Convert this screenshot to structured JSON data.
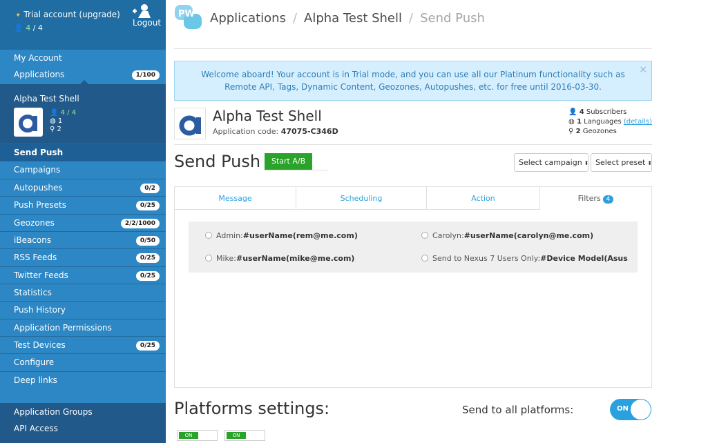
{
  "sidebar": {
    "trial": "Trial account (upgrade)",
    "users": {
      "current": "4",
      "total": "/ 4"
    },
    "logout": "Logout",
    "my_account": "My Account",
    "applications": {
      "label": "Applications",
      "badge": "1/100"
    },
    "app": {
      "name": "Alpha Test Shell",
      "users": "4 / 4",
      "stat2": "1",
      "stat3": "2"
    },
    "items": [
      {
        "label": "Send Push",
        "badge": ""
      },
      {
        "label": "Campaigns",
        "badge": ""
      },
      {
        "label": "Autopushes",
        "badge": "0/2"
      },
      {
        "label": "Push Presets",
        "badge": "0/25"
      },
      {
        "label": "Geozones",
        "badge": "2/2/1000"
      },
      {
        "label": "iBeacons",
        "badge": "0/50"
      },
      {
        "label": "RSS Feeds",
        "badge": "0/25"
      },
      {
        "label": "Twitter Feeds",
        "badge": "0/25"
      },
      {
        "label": "Statistics",
        "badge": ""
      },
      {
        "label": "Push History",
        "badge": ""
      },
      {
        "label": "Application Permissions",
        "badge": ""
      },
      {
        "label": "Test Devices",
        "badge": "0/25"
      },
      {
        "label": "Configure",
        "badge": ""
      },
      {
        "label": "Deep links",
        "badge": ""
      }
    ],
    "bottom": [
      "Application Groups",
      "API Access"
    ]
  },
  "header": {
    "logo": "PW",
    "breadcrumbs": [
      "Applications",
      "Alpha Test Shell",
      "Send Push"
    ]
  },
  "welcome": {
    "text": "Welcome aboard! Your account is in Trial mode, and you can use all our Platinum functionality such as Remote API, Tags, Dynamic Content, Geozones, Autopushes, etc. for free until 2016-03-30.",
    "close": "×"
  },
  "app_info": {
    "title": "Alpha Test Shell",
    "code_label": "Application code:",
    "code": "47075-C346D",
    "subscribers_num": "4",
    "subscribers_label": "Subscribers",
    "languages_num": "1",
    "languages_label": "Languages",
    "languages_link": "(details)",
    "geozones_num": "2",
    "geozones_label": "Geozones"
  },
  "send_push": {
    "title": "Send Push",
    "start_ab": "Start A/B",
    "select_campaign": "Select campaign",
    "select_preset": "Select preset"
  },
  "tabs": [
    {
      "label": "Message"
    },
    {
      "label": "Scheduling"
    },
    {
      "label": "Action"
    },
    {
      "label": "Filters",
      "count": "4"
    }
  ],
  "filters": [
    {
      "name": "Admin:",
      "rule": "#userName(rem@me.com)"
    },
    {
      "name": "Carolyn:",
      "rule": "#userName(carolyn@me.com)"
    },
    {
      "name": "Mike:",
      "rule": "#userName(mike@me.com)"
    },
    {
      "name": "Send to Nexus 7 Users Only:",
      "rule": "#Device Model(Asus..."
    }
  ],
  "platforms": {
    "title": "Platforms settings:",
    "send_all_label": "Send to all platforms:",
    "toggle": "ON",
    "mini_on": "ON"
  },
  "colors": {
    "sidebar": "#2c87c4",
    "sidebar_dark": "#20598a",
    "accent": "#2aa1df",
    "green": "#2aa32a",
    "info_bg": "#d6efff"
  }
}
